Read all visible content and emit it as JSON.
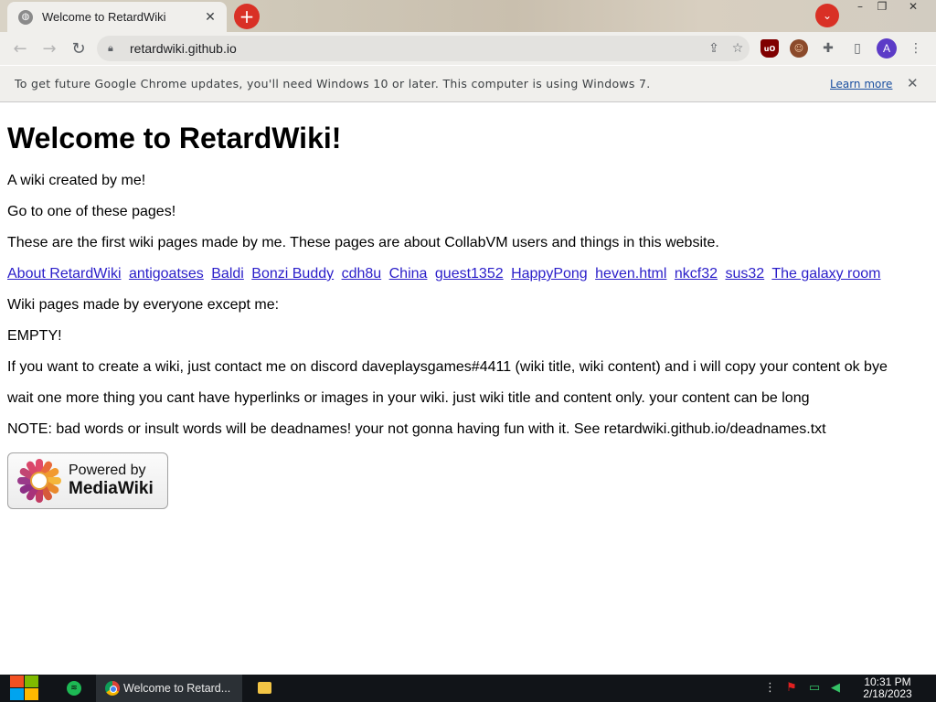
{
  "browser": {
    "tab_title": "Welcome to RetardWiki",
    "new_tab_label": "+",
    "url": "retardwiki.github.io",
    "profile_initial": "A",
    "ext_ublock_label": "uO"
  },
  "infobar": {
    "message": "To get future Google Chrome updates, you'll need Windows 10 or later. This computer is using Windows 7.",
    "learn_more": "Learn more"
  },
  "page": {
    "heading": "Welcome to RetardWiki!",
    "intro": "A wiki created by me!",
    "go_to": "Go to one of these pages!",
    "first_pages_note": "These are the first wiki pages made by me. These pages are about CollabVM users and things in this website.",
    "links": [
      "About RetardWiki",
      "antigoatses",
      "Baldi",
      "Bonzi Buddy",
      "cdh8u",
      "China",
      "guest1352",
      "HappyPong",
      "heven.html",
      "nkcf32",
      "sus32",
      "The galaxy room"
    ],
    "everyone_pages": "Wiki pages made by everyone except me:",
    "empty": "EMPTY!",
    "create_note": "If you want to create a wiki, just contact me on discord daveplaysgames#4411 (wiki title, wiki content) and i will copy your content ok bye",
    "wait_note": "wait one more thing you cant have hyperlinks or images in your wiki. just wiki title and content only. your content can be long",
    "bad_words_note": "NOTE: bad words or insult words will be deadnames! your not gonna having fun with it. See retardwiki.github.io/deadnames.txt",
    "badge_line1": "Powered by",
    "badge_line2": "MediaWiki"
  },
  "taskbar": {
    "chrome_label": "Welcome to Retard...",
    "time": "10:31 PM",
    "date": "2/18/2023"
  },
  "colors": {
    "link": "#2a1ec9",
    "accent_red": "#d93025",
    "profile": "#5c3bc7"
  },
  "icons": [
    "globe-icon",
    "close-icon",
    "plus-icon",
    "chevron-down-icon",
    "back-arrow-icon",
    "forward-arrow-icon",
    "reload-icon",
    "lock-icon",
    "share-icon",
    "star-icon",
    "ublock-icon",
    "puzzle-icon",
    "side-panel-icon",
    "kebab-menu-icon",
    "windows-start-icon",
    "spotify-icon",
    "chrome-icon",
    "folder-icon",
    "flag-icon",
    "network-icon",
    "volume-icon"
  ]
}
